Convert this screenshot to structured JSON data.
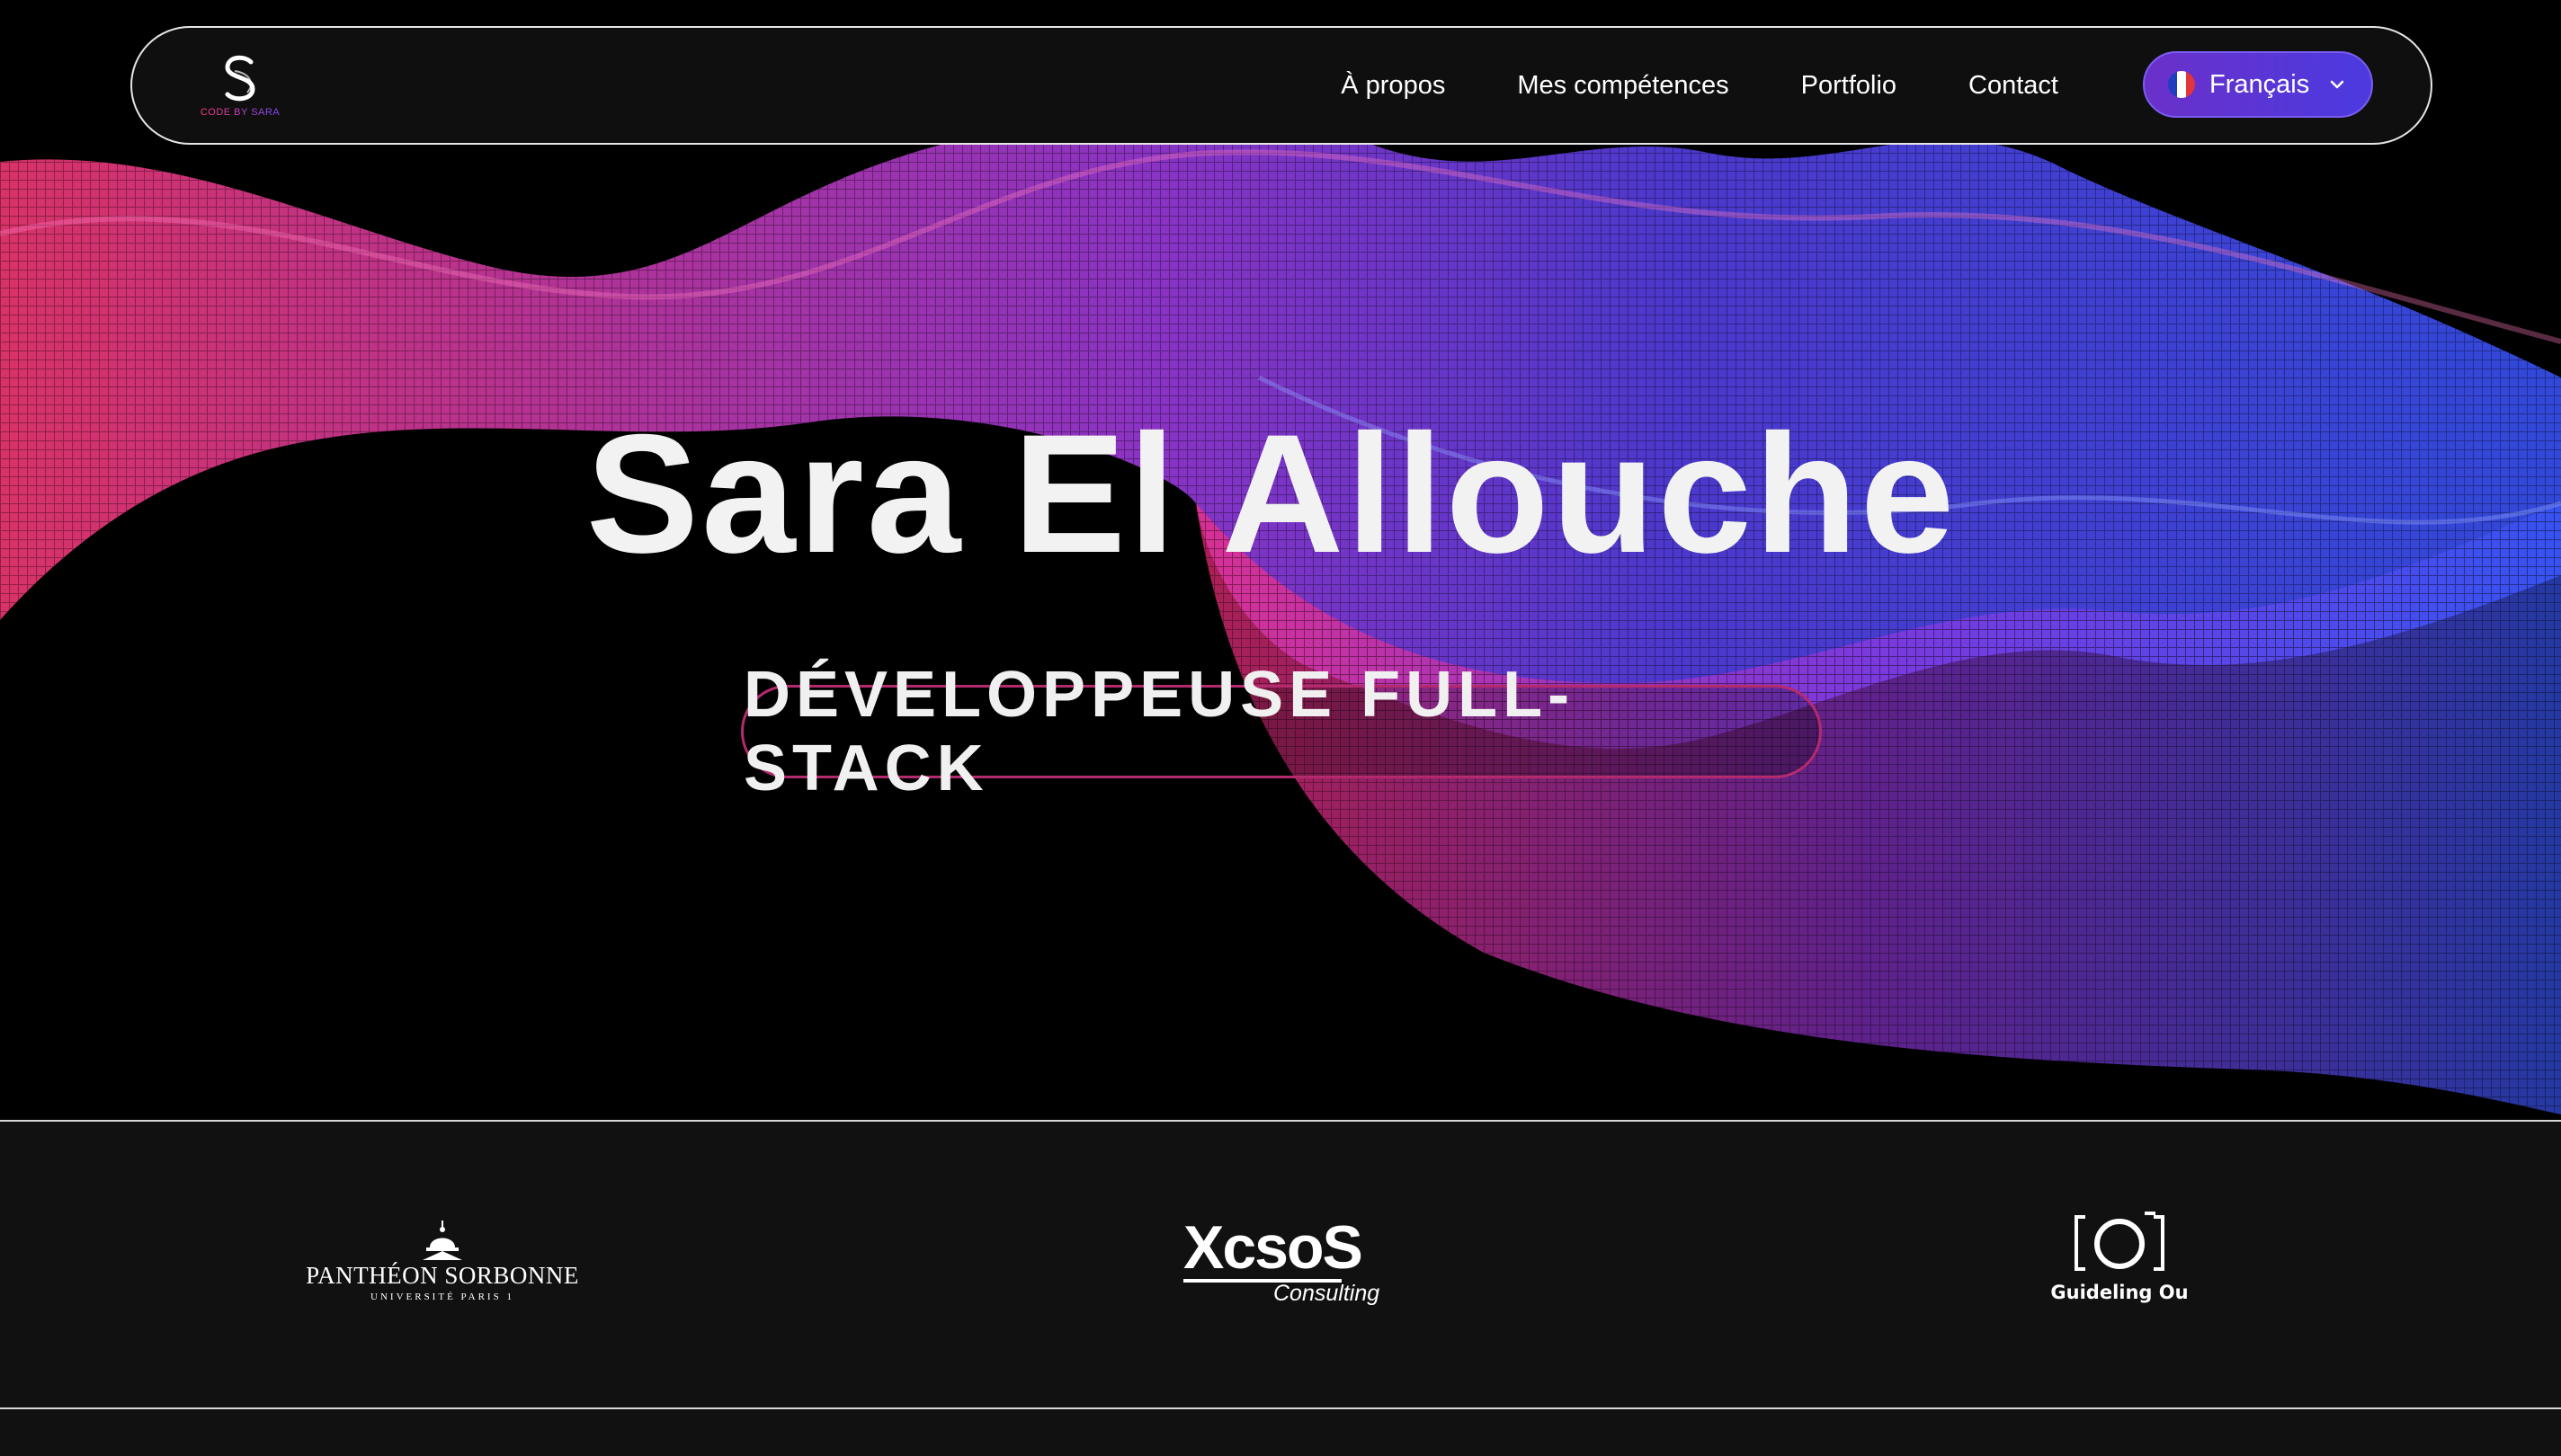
{
  "nav": {
    "logo_caption": "CODE BY SARA",
    "links": [
      "À propos",
      "Mes compétences",
      "Portfolio",
      "Contact"
    ],
    "language": {
      "label": "Français",
      "flag_icon": "france-flag-icon",
      "dropdown_icon": "chevron-down-icon"
    }
  },
  "hero": {
    "name": "Sara El Allouche",
    "role": "DÉVELOPPEUSE FULL-STACK"
  },
  "partners": [
    {
      "name": "PANTHÉON SORBONNE",
      "subtitle": "UNIVERSITÉ PARIS 1",
      "icon": "pantheon-dome-icon"
    },
    {
      "name": "XcsoS",
      "subtitle": "Consulting"
    },
    {
      "name": "Guideling Ou",
      "icon": "camera-icon"
    }
  ],
  "colors": {
    "accent_pink": "#ff3b7a",
    "accent_purple": "#7b3cf0",
    "accent_blue": "#3c4df0",
    "pill_border": "#b42a6e",
    "background": "#000000",
    "panel": "#111112"
  }
}
